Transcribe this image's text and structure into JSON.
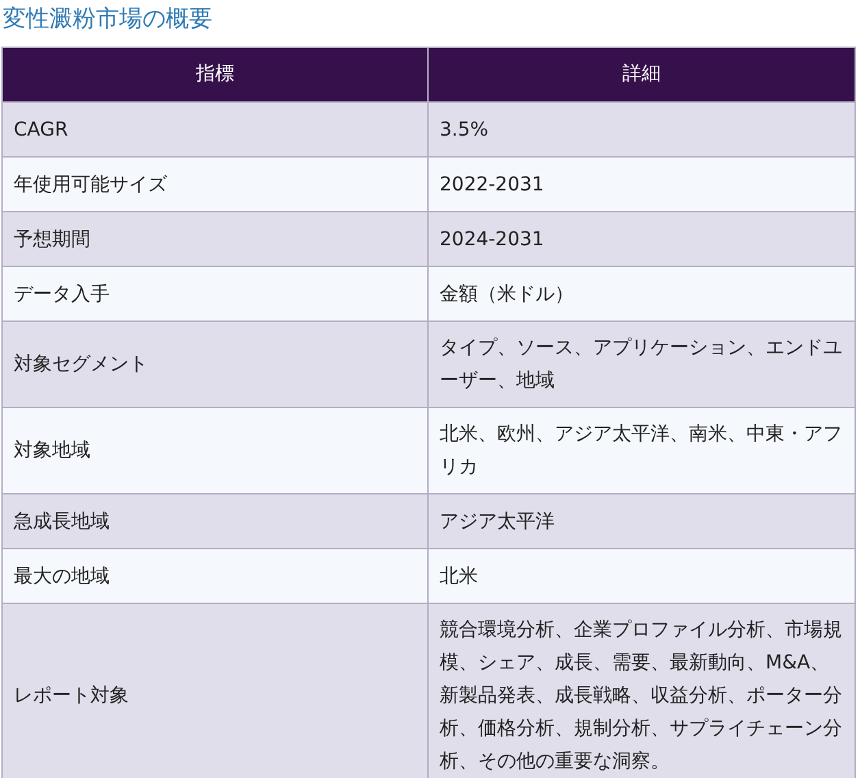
{
  "title": "変性澱粉市場の概要",
  "table": {
    "columns": [
      "指標",
      "詳細"
    ],
    "rows": [
      [
        "CAGR",
        "3.5%"
      ],
      [
        "年使用可能サイズ",
        "2022-2031"
      ],
      [
        "予想期間",
        "2024-2031"
      ],
      [
        "データ入手",
        "金額（米ドル）"
      ],
      [
        "対象セグメント",
        "タイプ、ソース、アプリケーション、エンドユーザー、地域"
      ],
      [
        "対象地域",
        "北米、欧州、アジア太平洋、南米、中東・アフリカ"
      ],
      [
        "急成長地域",
        "アジア太平洋"
      ],
      [
        "最大の地域",
        "北米"
      ],
      [
        "レポート対象",
        "競合環境分析、企業プロファイル分析、市場規模、シェア、成長、需要、最新動向、M&A、新製品発表、成長戦略、収益分析、ポーター分析、価格分析、規制分析、サプライチェーン分析、その他の重要な洞察。"
      ]
    ]
  }
}
